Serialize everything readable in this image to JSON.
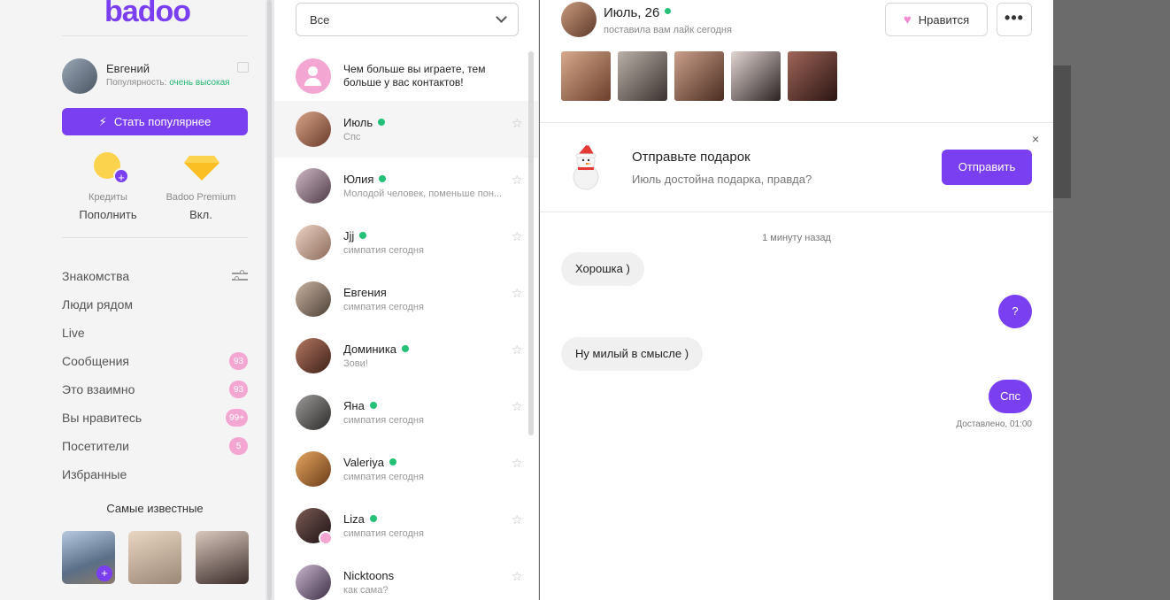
{
  "brand": {
    "logo": "badoo"
  },
  "profile": {
    "name": "Евгений",
    "popularity_label": "Популярность:",
    "popularity_value": "очень высокая",
    "cta_label": "Стать популярнее"
  },
  "wallet": {
    "credits_caption": "Кредиты",
    "credits_action": "Пополнить",
    "premium_caption": "Badoo Premium",
    "premium_status": "Вкл."
  },
  "nav": {
    "items": [
      {
        "label": "Знакомства",
        "badge": ""
      },
      {
        "label": "Люди рядом",
        "badge": ""
      },
      {
        "label": "Live",
        "badge": ""
      },
      {
        "label": "Сообщения",
        "badge": "93"
      },
      {
        "label": "Это взаимно",
        "badge": "93"
      },
      {
        "label": "Вы нравитесь",
        "badge": "99+"
      },
      {
        "label": "Посетители",
        "badge": "5"
      },
      {
        "label": "Избранные",
        "badge": ""
      }
    ]
  },
  "famous": {
    "title": "Самые известные"
  },
  "conversations": {
    "filter": "Все",
    "promo_text": "Чем больше вы играете, тем больше у вас контактов!",
    "items": [
      {
        "name": "Июль",
        "preview": "Спс"
      },
      {
        "name": "Юлия",
        "preview": "Молодой человек, поменьше пон..."
      },
      {
        "name": "Jjj",
        "preview": "симпатия сегодня"
      },
      {
        "name": "Евгения",
        "preview": "симпатия сегодня"
      },
      {
        "name": "Доминика",
        "preview": "Зови!"
      },
      {
        "name": "Яна",
        "preview": "симпатия сегодня"
      },
      {
        "name": "Valeriya",
        "preview": "симпатия сегодня"
      },
      {
        "name": "Liza",
        "preview": "симпатия сегодня"
      },
      {
        "name": "Nicktoons",
        "preview": "как сама?"
      }
    ]
  },
  "chat": {
    "header": {
      "name": "Июль, 26",
      "status": "поставила вам лайк сегодня",
      "like_label": "Нравится",
      "more_label": "•••"
    },
    "gift": {
      "title": "Отправьте подарок",
      "text": "Июль достойна подарка, правда?",
      "send_label": "Отправить",
      "close_label": "×"
    },
    "timestamp": "1 минуту назад",
    "messages": [
      {
        "text": "Хорошка )"
      },
      {
        "text": "?"
      },
      {
        "text": "Ну милый в смысле )"
      },
      {
        "text": "Спс"
      }
    ],
    "delivered": "Доставлено, 01:00"
  },
  "colors": {
    "accent": "#7b3ff2",
    "online": "#23c076",
    "badge": "#f4a6d3"
  }
}
